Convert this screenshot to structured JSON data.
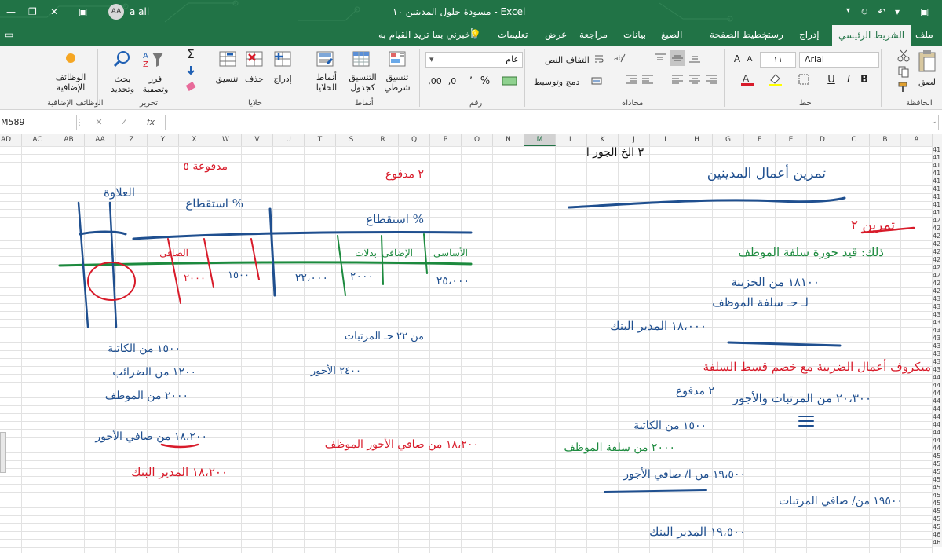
{
  "titlebar": {
    "title": "مسودة حلول المدينين ١٠  -  Excel",
    "user_name": "a ali",
    "avatar_initials": "AA"
  },
  "tabs": [
    {
      "label": "ملف"
    },
    {
      "label": "الشريط الرئيسي",
      "active": true
    },
    {
      "label": "إدراج"
    },
    {
      "label": "رسم"
    },
    {
      "label": "تخطيط الصفحة"
    },
    {
      "label": "الصيغ"
    },
    {
      "label": "بيانات"
    },
    {
      "label": "مراجعة"
    },
    {
      "label": "عرض"
    },
    {
      "label": "تعليمات"
    }
  ],
  "tell_me": "أخبرني بما تريد القيام به",
  "ribbon": {
    "clipboard": {
      "group": "الحافظة",
      "paste": "لصق"
    },
    "font": {
      "group": "خط",
      "name": "Arial",
      "size": "١١",
      "bold": "B",
      "italic": "I",
      "underline": "U"
    },
    "alignment": {
      "group": "محاذاة",
      "wrap": "التفاف النص",
      "merge": "دمج وتوسيط"
    },
    "number": {
      "group": "رقم",
      "format": "عام",
      "percent": "%"
    },
    "styles": {
      "group": "أنماط",
      "conditional": "تنسيق شرطي",
      "as_table": "التنسيق كجدول",
      "cell_styles": "أنماط الخلايا"
    },
    "cells": {
      "group": "خلايا",
      "insert": "إدراج",
      "delete": "حذف",
      "format": "تنسيق"
    },
    "editing": {
      "group": "تحرير",
      "sort": "فرز وتصفية",
      "find": "بحث وتحديد"
    },
    "addins": {
      "group": "الوظائف الإضافية",
      "label": "الوظائف الإضافية"
    }
  },
  "formula_bar": {
    "name_box": "M589",
    "fx": "fx",
    "value": ""
  },
  "columns": [
    "A",
    "B",
    "C",
    "D",
    "E",
    "F",
    "G",
    "H",
    "I",
    "J",
    "K",
    "L",
    "M",
    "N",
    "O",
    "P",
    "Q",
    "R",
    "S",
    "T",
    "U",
    "V",
    "W",
    "X",
    "Y",
    "Z",
    "AA",
    "AB",
    "AC",
    "AD"
  ],
  "selected_column": "M",
  "row_numbers": [
    "41",
    "41",
    "41",
    "41",
    "41",
    "41",
    "41",
    "41",
    "41",
    "42",
    "42",
    "42",
    "42",
    "42",
    "42",
    "42",
    "42",
    "42",
    "42",
    "43",
    "43",
    "43",
    "43",
    "43",
    "43",
    "43",
    "43",
    "43",
    "43",
    "44",
    "44",
    "44",
    "44",
    "44",
    "44",
    "44",
    "44",
    "44",
    "44",
    "45",
    "45",
    "45",
    "45",
    "45",
    "45",
    "45",
    "45",
    "45",
    "45",
    "46",
    "46"
  ],
  "colors": {
    "excel_green": "#217346",
    "ink_blue": "#1f4f8f",
    "ink_green": "#1c8a3e",
    "ink_red": "#d81b2a",
    "ink_black": "#111111"
  },
  "ink": {
    "blue": {
      "h1": "تمرين أعمال المدينين",
      "r1": "١٨١٠٠ من الخزينة",
      "r2": "لـ حـ سلفة الموظف",
      "r3": "١٨،٠٠٠ المدير البنك",
      "r4": "٢٠،٣٠٠ من المرتبات والأجور",
      "r5": "١٥٠٠ من الكاتبة",
      "r6": "١٩،٥٠٠ من ا/ صافي الأجور",
      "r7": "١٩٥٠٠ من/ صافي المرتبات",
      "r8": "١٩،٥٠٠ المدير البنك",
      "top": "٣ الخ الجور ا",
      "table_h1": "الصافي",
      "table_h2": "الأساسي",
      "table_h3": "الإضافي",
      "table_h4": "بدلات",
      "table_h5": "العلاوة",
      "table_v1": "٢٥،٠٠٠",
      "table_v2": "٢٠٠٠",
      "table_v3": "١٥٠٠",
      "table_v4": "٢٢،٠٠٠",
      "istiq": "استقطاع %",
      "l1": "١٥٠٠ من الكاتبة",
      "l2": "١٢٠٠ من الضرائب",
      "l3": "٢٠٠٠ من الموظف",
      "l4": "١٨،٢٠٠ من صافي الأجور",
      "m1": "من ٢٢ حـ المرتبات",
      "m2": "٢٤٠٠ الأجور",
      "l5": "١٨،٢٠٠ المدير البنك"
    },
    "red": {
      "h1": "تمرين ٢",
      "r1": "ميكروف أعمال الضريبة مع خصم قسط السلفة",
      "l1": "١٨،٢٠٠ من صافي الأجور الموظف",
      "tbl_a": "٢٠٠٠",
      "tbl_b": "٢٠٠٠"
    },
    "green": {
      "h1": "ذلك: قيد حوزة سلفة الموظف",
      "r1": "سلفة الموظف",
      "r2": "٢٠٠٠ من سلفة الموظف"
    },
    "red_note": "٢ مدفوع",
    "red_note2": "مدفوعة ٥"
  }
}
